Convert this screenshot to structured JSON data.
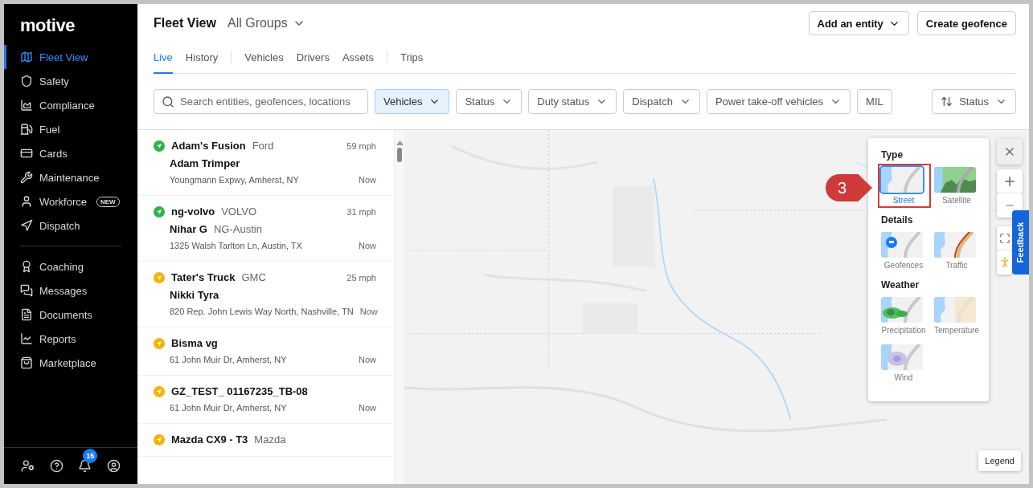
{
  "sidebar": {
    "logo": "motive",
    "groups": [
      [
        {
          "label": "Fleet View",
          "selected": true
        },
        {
          "label": "Safety",
          "selected": false
        },
        {
          "label": "Compliance",
          "selected": false
        },
        {
          "label": "Fuel",
          "selected": false
        },
        {
          "label": "Cards",
          "selected": false
        },
        {
          "label": "Maintenance",
          "selected": false
        },
        {
          "label": "Workforce",
          "selected": false,
          "badge": "NEW"
        },
        {
          "label": "Dispatch",
          "selected": false
        }
      ],
      [
        {
          "label": "Coaching",
          "selected": false
        },
        {
          "label": "Messages",
          "selected": false
        },
        {
          "label": "Documents",
          "selected": false
        },
        {
          "label": "Reports",
          "selected": false
        },
        {
          "label": "Marketplace",
          "selected": false
        }
      ]
    ],
    "notification_count": "15"
  },
  "header": {
    "title": "Fleet View",
    "group_selector": "All Groups",
    "buttons": [
      {
        "label": "Add an entity",
        "kind": "dropdown"
      },
      {
        "label": "Create geofence",
        "kind": "plain"
      }
    ]
  },
  "tab_groups": [
    [
      {
        "label": "Live",
        "selected": true
      },
      {
        "label": "History",
        "selected": false
      }
    ],
    [
      {
        "label": "Vehicles",
        "selected": false
      },
      {
        "label": "Drivers",
        "selected": false
      },
      {
        "label": "Assets",
        "selected": false
      }
    ],
    [
      {
        "label": "Trips",
        "selected": false
      }
    ]
  ],
  "search": {
    "placeholder": "Search entities, geofences, locations"
  },
  "filters": [
    {
      "label": "Vehicles",
      "kind": "dropdown",
      "selected": true
    },
    {
      "label": "Status",
      "kind": "dropdown",
      "selected": false
    },
    {
      "label": "Duty status",
      "kind": "dropdown",
      "selected": false
    },
    {
      "label": "Dispatch",
      "kind": "dropdown",
      "selected": false
    },
    {
      "label": "Power take-off vehicles",
      "kind": "dropdown",
      "selected": false
    },
    {
      "label": "MIL",
      "kind": "toggle",
      "selected": false
    }
  ],
  "sort": {
    "label": "Status"
  },
  "vehicles": [
    {
      "name": "Adam's Fusion",
      "make": "Ford",
      "speed": "59 mph",
      "driver": "Adam Trimper",
      "address": "Youngmann Expwy, Amherst, NY",
      "time": "Now",
      "color": "#2fb24c"
    },
    {
      "name": "ng-volvo",
      "make": "VOLVO",
      "speed": "31 mph",
      "driver": "Nihar G",
      "driver_group": "NG-Austin",
      "address": "1325 Walsh Tarlton Ln, Austin, TX",
      "time": "Now",
      "color": "#2fb24c"
    },
    {
      "name": "Tater's Truck",
      "make": "GMC",
      "speed": "25 mph",
      "driver": "Nikki Tyra",
      "address": "820 Rep. John Lewis Way North, Nashville, TN",
      "time": "Now",
      "color": "#f5b400"
    },
    {
      "name": "Bisma vg",
      "address": "61 John Muir Dr, Amherst, NY",
      "time": "Now",
      "color": "#f5b400"
    },
    {
      "name": "GZ_TEST_ 01167235_TB-08",
      "address": "61 John Muir Dr, Amherst, NY",
      "time": "Now",
      "color": "#f5b400"
    },
    {
      "name": "Mazda CX9 - T3",
      "make": "Mazda",
      "color": "#f5b400"
    }
  ],
  "map": {
    "kind": "picture",
    "map_layers": {
      "sections": [
        {
          "title": "Type",
          "options": [
            {
              "label": "Street",
              "selected": true,
              "highlighted": true
            },
            {
              "label": "Satellite",
              "selected": false,
              "highlighted": false
            }
          ]
        },
        {
          "title": "Details",
          "options": [
            {
              "label": "Geofences",
              "selected": false,
              "highlighted": false
            },
            {
              "label": "Traffic",
              "selected": false,
              "highlighted": false
            }
          ]
        },
        {
          "title": "Weather",
          "options": [
            {
              "label": "Precipitation",
              "selected": false,
              "highlighted": false
            },
            {
              "label": "Temperature",
              "selected": false,
              "highlighted": false
            },
            {
              "label": "Wind",
              "selected": false,
              "highlighted": false
            }
          ]
        }
      ]
    },
    "annotation": {
      "number": "3"
    },
    "feedback": "Feedback",
    "legend": "Legend"
  }
}
